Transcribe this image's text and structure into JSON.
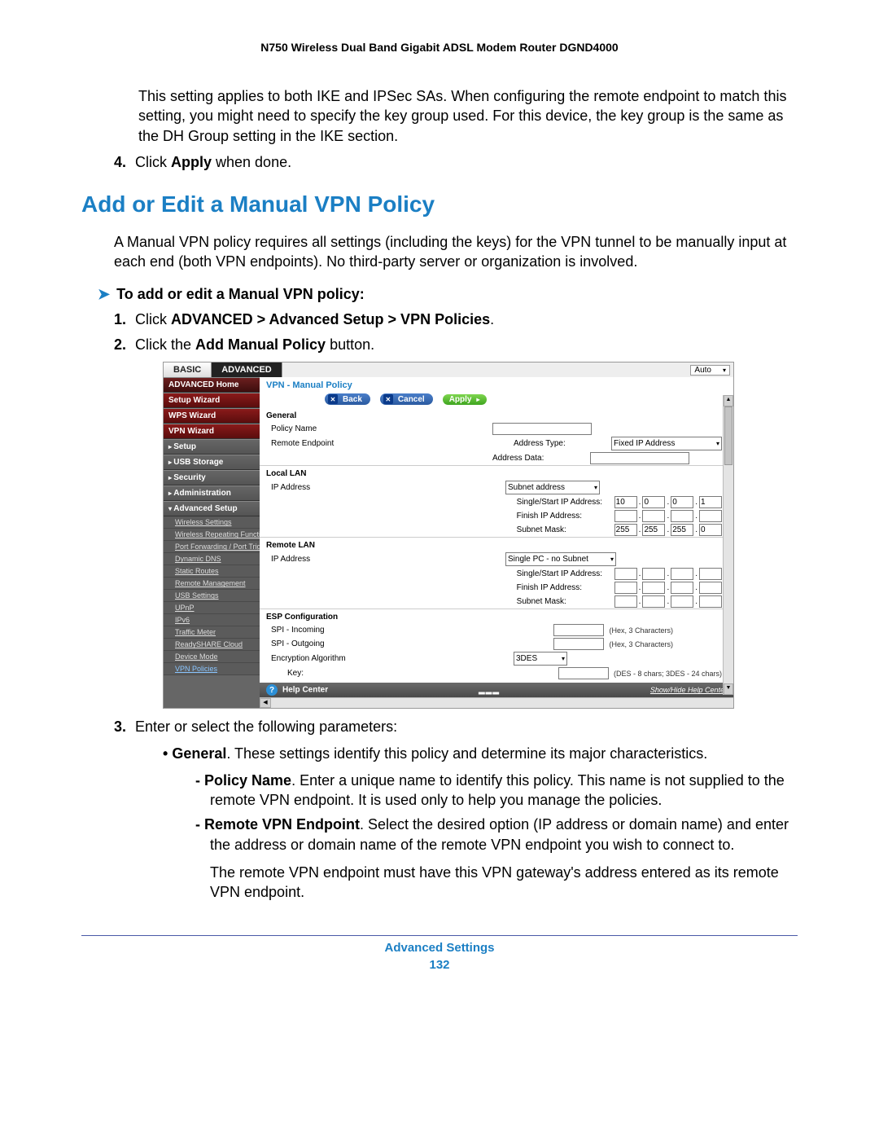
{
  "doc_header": "N750 Wireless Dual Band Gigabit ADSL Modem Router DGND4000",
  "intro_para": "This setting applies to both IKE and IPSec SAs. When configuring the remote endpoint to match this setting, you might need to specify the key group used. For this device, the key group is the same as the DH Group setting in the IKE section.",
  "step4_pre": "Click ",
  "step4_bold": "Apply",
  "step4_post": " when done.",
  "section_heading": "Add or Edit a Manual VPN Policy",
  "section_para": "A Manual VPN policy requires all settings (including the keys) for the VPN tunnel to be manually input at each end (both VPN endpoints). No third-party server or organization is involved.",
  "proc_title": "To add or edit a Manual VPN policy:",
  "s1_pre": "Click ",
  "s1_bold": "ADVANCED > Advanced Setup > VPN Policies",
  "s1_post": ".",
  "s2_pre": "Click the ",
  "s2_bold": "Add Manual Policy",
  "s2_post": " button.",
  "s3": "Enter or select the following parameters:",
  "b1_bold": "General",
  "b1_post": ". These settings identify this policy and determine its major characteristics.",
  "d1_bold": "Policy Name",
  "d1_post": ". Enter a unique name to identify this policy. This name is not supplied to the remote VPN endpoint. It is used only to help you manage the policies.",
  "d2_bold": "Remote VPN Endpoint",
  "d2_post": ". Select the desired option (IP address or domain name) and enter the address or domain name of the remote VPN endpoint you wish to connect to.",
  "d2_extra": "The remote VPN endpoint must have this VPN gateway's address entered as its remote VPN endpoint.",
  "footer_title": "Advanced Settings",
  "page_number": "132",
  "router": {
    "tabs": {
      "basic": "BASIC",
      "advanced": "ADVANCED",
      "auto": "Auto"
    },
    "sidebar": {
      "home": "ADVANCED Home",
      "setup_wizard": "Setup Wizard",
      "wps_wizard": "WPS Wizard",
      "vpn_wizard": "VPN Wizard",
      "setup": "Setup",
      "usb": "USB Storage",
      "security": "Security",
      "admin": "Administration",
      "adv_setup": "Advanced Setup",
      "subs": {
        "wireless": "Wireless Settings",
        "repeat": "Wireless Repeating Function",
        "portfwd": "Port Forwarding / Port Triggering",
        "ddns": "Dynamic DNS",
        "static": "Static Routes",
        "remote": "Remote Management",
        "usb_s": "USB Settings",
        "upnp": "UPnP",
        "ipv6": "IPv6",
        "traffic": "Traffic Meter",
        "rshare": "ReadySHARE Cloud",
        "devmode": "Device Mode",
        "vpnpol": "VPN Policies"
      }
    },
    "panel": {
      "title": "VPN - Manual Policy",
      "back": "Back",
      "cancel": "Cancel",
      "apply": "Apply",
      "general_hdr": "General",
      "policy_name": "Policy Name",
      "remote_ep": "Remote Endpoint",
      "addr_type_lbl": "Address Type:",
      "addr_type_val": "Fixed IP Address",
      "addr_data": "Address Data:",
      "local_lan_hdr": "Local LAN",
      "ip_addr": "IP Address",
      "subnet_sel": "Subnet address",
      "single_start": "Single/Start IP Address:",
      "finish_ip": "Finish IP Address:",
      "subnet_mask": "Subnet Mask:",
      "ip1": "10",
      "ip2": "0",
      "ip3": "0",
      "ip4": "1",
      "sm1": "255",
      "sm2": "255",
      "sm3": "255",
      "sm4": "0",
      "remote_lan_hdr": "Remote LAN",
      "remote_sel": "Single PC - no Subnet",
      "esp_hdr": "ESP Configuration",
      "spi_in": "SPI - Incoming",
      "spi_out": "SPI - Outgoing",
      "enc_alg": "Encryption Algorithm",
      "enc_alg_val": "3DES",
      "key_lbl": "Key:",
      "hex_hint": "(Hex, 3 Characters)",
      "des_hint": "(DES - 8 chars; 3DES - 24 chars)",
      "help_center": "Help Center",
      "showhide": "Show/Hide Help Center"
    }
  }
}
